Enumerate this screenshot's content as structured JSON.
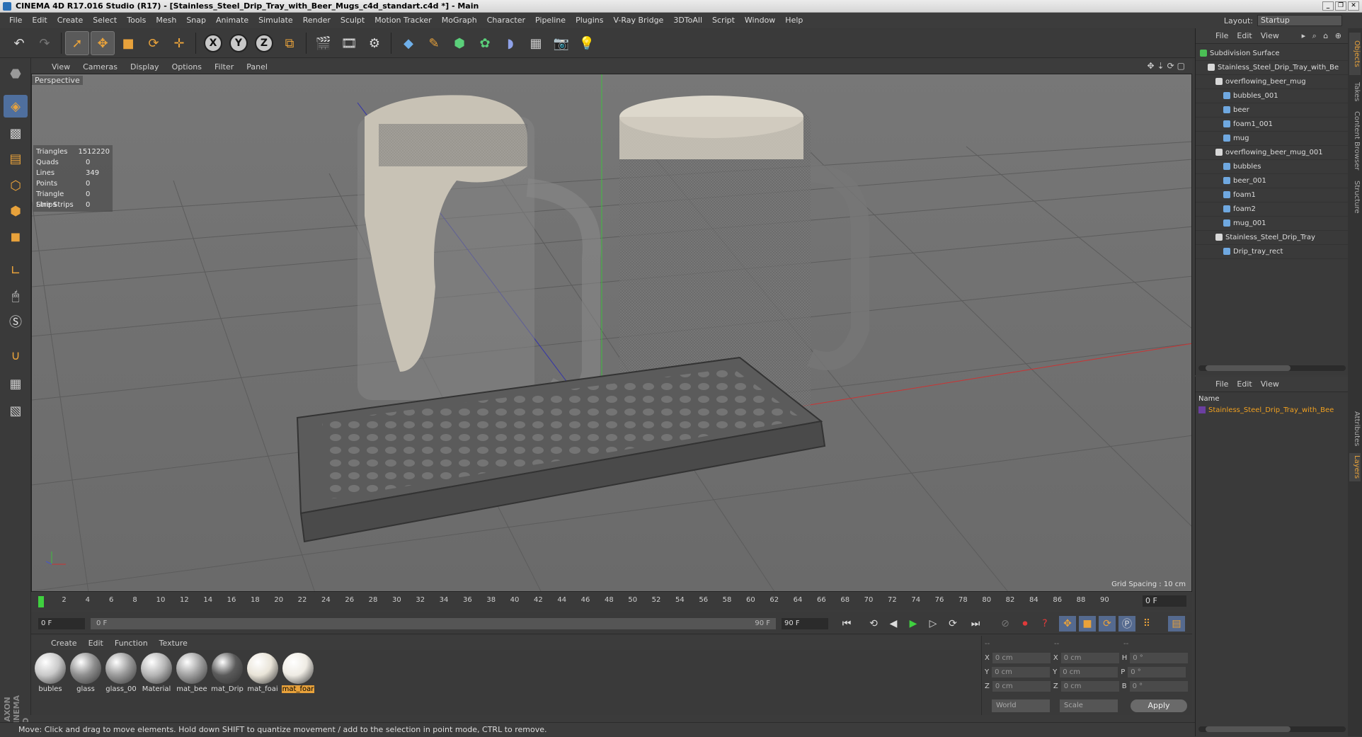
{
  "window": {
    "title": "CINEMA 4D R17.016 Studio (R17) - [Stainless_Steel_Drip_Tray_with_Beer_Mugs_c4d_standart.c4d *] - Main",
    "controls": [
      "_",
      "❐",
      "✕"
    ]
  },
  "menu": [
    "File",
    "Edit",
    "Create",
    "Select",
    "Tools",
    "Mesh",
    "Snap",
    "Animate",
    "Simulate",
    "Render",
    "Sculpt",
    "Motion Tracker",
    "MoGraph",
    "Character",
    "Pipeline",
    "Plugins",
    "V-Ray Bridge",
    "3DToAll",
    "Script",
    "Window",
    "Help"
  ],
  "layout": {
    "label": "Layout:",
    "value": "Startup"
  },
  "toolbar": {
    "undo_icon": "undo-icon",
    "redo_icon": "redo-icon",
    "axis_x": "X",
    "axis_y": "Y",
    "axis_z": "Z"
  },
  "viewport": {
    "menu": [
      "View",
      "Cameras",
      "Display",
      "Options",
      "Filter",
      "Panel"
    ],
    "camera": "Perspective",
    "stats": [
      {
        "k": "Triangles",
        "v": "1512220"
      },
      {
        "k": "Quads",
        "v": "0"
      },
      {
        "k": "Lines",
        "v": "349"
      },
      {
        "k": "Points",
        "v": "0"
      },
      {
        "k": "Triangle Strips",
        "v": "0"
      },
      {
        "k": "Line Strips",
        "v": "0"
      }
    ],
    "grid_spacing": "Grid Spacing : 10 cm"
  },
  "timeline": {
    "ticks": [
      "0",
      "2",
      "4",
      "6",
      "8",
      "10",
      "12",
      "14",
      "16",
      "18",
      "20",
      "22",
      "24",
      "26",
      "28",
      "30",
      "32",
      "34",
      "36",
      "38",
      "40",
      "42",
      "44",
      "46",
      "48",
      "50",
      "52",
      "54",
      "56",
      "58",
      "60",
      "62",
      "64",
      "66",
      "68",
      "70",
      "72",
      "74",
      "76",
      "78",
      "80",
      "82",
      "84",
      "86",
      "88",
      "90"
    ],
    "current_frame": "0 F",
    "start": "0 F",
    "range_start": "0 F",
    "range_end": "90 F",
    "end": "90 F"
  },
  "materials": {
    "menu": [
      "Create",
      "Edit",
      "Function",
      "Texture"
    ],
    "items": [
      {
        "name": "bubles",
        "color": "#c9c9c9"
      },
      {
        "name": "glass",
        "color": "#8f8f8f"
      },
      {
        "name": "glass_00",
        "color": "#9a9a9a"
      },
      {
        "name": "Material",
        "color": "#b5b5b5"
      },
      {
        "name": "mat_bee",
        "color": "#a0a0a0"
      },
      {
        "name": "mat_Drip",
        "color": "#5a5a5a"
      },
      {
        "name": "mat_foai",
        "color": "#e9e4d8"
      },
      {
        "name": "mat_foar",
        "color": "#efece4"
      }
    ],
    "selected_index": 7
  },
  "coords": {
    "headers": [
      "--",
      "--",
      "--"
    ],
    "rows": [
      {
        "a": "X",
        "av": "0 cm",
        "b": "X",
        "bv": "0 cm",
        "c": "H",
        "cv": "0 °"
      },
      {
        "a": "Y",
        "av": "0 cm",
        "b": "Y",
        "bv": "0 cm",
        "c": "P",
        "cv": "0 °"
      },
      {
        "a": "Z",
        "av": "0 cm",
        "b": "Z",
        "bv": "0 cm",
        "c": "B",
        "cv": "0 °"
      }
    ],
    "world": "World",
    "scale": "Scale",
    "apply": "Apply"
  },
  "status": "Move: Click and drag to move elements. Hold down SHIFT to quantize movement / add to the selection in point mode, CTRL to remove.",
  "objects": {
    "menu": [
      "File",
      "Edit",
      "View"
    ],
    "items": [
      {
        "name": "Subdivision Surface",
        "depth": 0,
        "type": "sds"
      },
      {
        "name": "Stainless_Steel_Drip_Tray_with_Be",
        "depth": 1,
        "type": "null"
      },
      {
        "name": "overflowing_beer_mug",
        "depth": 2,
        "type": "null"
      },
      {
        "name": "bubbles_001",
        "depth": 3,
        "type": "poly"
      },
      {
        "name": "beer",
        "depth": 3,
        "type": "poly"
      },
      {
        "name": "foam1_001",
        "depth": 3,
        "type": "poly"
      },
      {
        "name": "mug",
        "depth": 3,
        "type": "poly"
      },
      {
        "name": "overflowing_beer_mug_001",
        "depth": 2,
        "type": "null"
      },
      {
        "name": "bubbles",
        "depth": 3,
        "type": "poly"
      },
      {
        "name": "beer_001",
        "depth": 3,
        "type": "poly"
      },
      {
        "name": "foam1",
        "depth": 3,
        "type": "poly"
      },
      {
        "name": "foam2",
        "depth": 3,
        "type": "poly"
      },
      {
        "name": "mug_001",
        "depth": 3,
        "type": "poly"
      },
      {
        "name": "Stainless_Steel_Drip_Tray",
        "depth": 2,
        "type": "null"
      },
      {
        "name": "Drip_tray_rect",
        "depth": 3,
        "type": "poly"
      }
    ]
  },
  "layers": {
    "menu": [
      "File",
      "Edit",
      "View"
    ],
    "header": "Name",
    "item": "Stainless_Steel_Drip_Tray_with_Bee"
  },
  "side_tabs_top": [
    "Objects",
    "Takes",
    "Content Browser",
    "Structure"
  ],
  "side_tabs_bottom": [
    "Attributes",
    "Layers"
  ],
  "colors": {
    "accent": "#e8a23b",
    "selection": "#f0a020"
  }
}
